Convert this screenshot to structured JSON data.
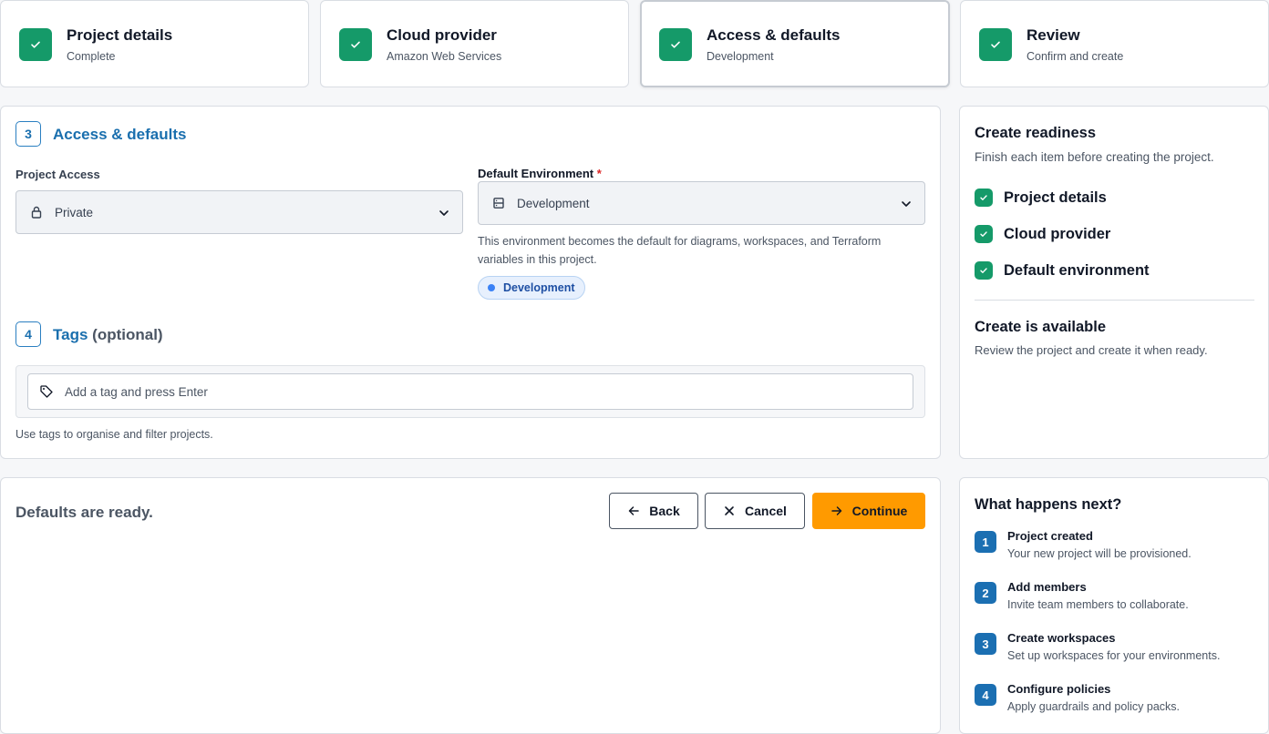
{
  "steps": [
    {
      "title": "Project details",
      "subtitle": "Complete"
    },
    {
      "title": "Cloud provider",
      "subtitle": "Amazon Web Services"
    },
    {
      "title": "Access & defaults",
      "subtitle": "Development"
    },
    {
      "title": "Review",
      "subtitle": "Confirm and create"
    }
  ],
  "access": {
    "section_number": "3",
    "section_title": "Access & defaults",
    "project_access_label": "Project Access",
    "project_access_value": "Private",
    "default_env_label": "Default Environment",
    "required_marker": "*",
    "default_env_value": "Development",
    "default_env_help": "This environment becomes the default for diagrams, workspaces, and Terraform variables in this project.",
    "env_pill": "Development"
  },
  "tags": {
    "section_number": "4",
    "section_title": "Tags",
    "optional_label": "(optional)",
    "placeholder": "Add a tag and press Enter",
    "help": "Use tags to organise and filter projects."
  },
  "footer": {
    "message": "Defaults are ready.",
    "back_label": "Back",
    "cancel_label": "Cancel",
    "continue_label": "Continue"
  },
  "readiness": {
    "title": "Create readiness",
    "subtitle": "Finish each item before creating the project.",
    "items": [
      "Project details",
      "Cloud provider",
      "Default environment"
    ],
    "available_title": "Create is available",
    "available_text": "Review the project and create it when ready."
  },
  "next_steps": {
    "title": "What happens next?",
    "items": [
      {
        "num": "1",
        "title": "Project created",
        "desc": "Your new project will be provisioned."
      },
      {
        "num": "2",
        "title": "Add members",
        "desc": "Invite team members to collaborate."
      },
      {
        "num": "3",
        "title": "Create workspaces",
        "desc": "Set up workspaces for your environments."
      },
      {
        "num": "4",
        "title": "Configure policies",
        "desc": "Apply guardrails and policy packs."
      }
    ]
  },
  "colors": {
    "success": "#159a69",
    "accent_blue": "#1a6fae",
    "primary_button": "#ff9a00",
    "required": "#dc2626"
  },
  "icons": {
    "step_status": "check-icon",
    "access": "lock-icon",
    "environment": "server-icon",
    "tag": "tag-icon",
    "back": "arrow-left-icon",
    "cancel": "close-icon",
    "continue": "arrow-right-icon",
    "dropdown": "chevron-down-icon"
  }
}
